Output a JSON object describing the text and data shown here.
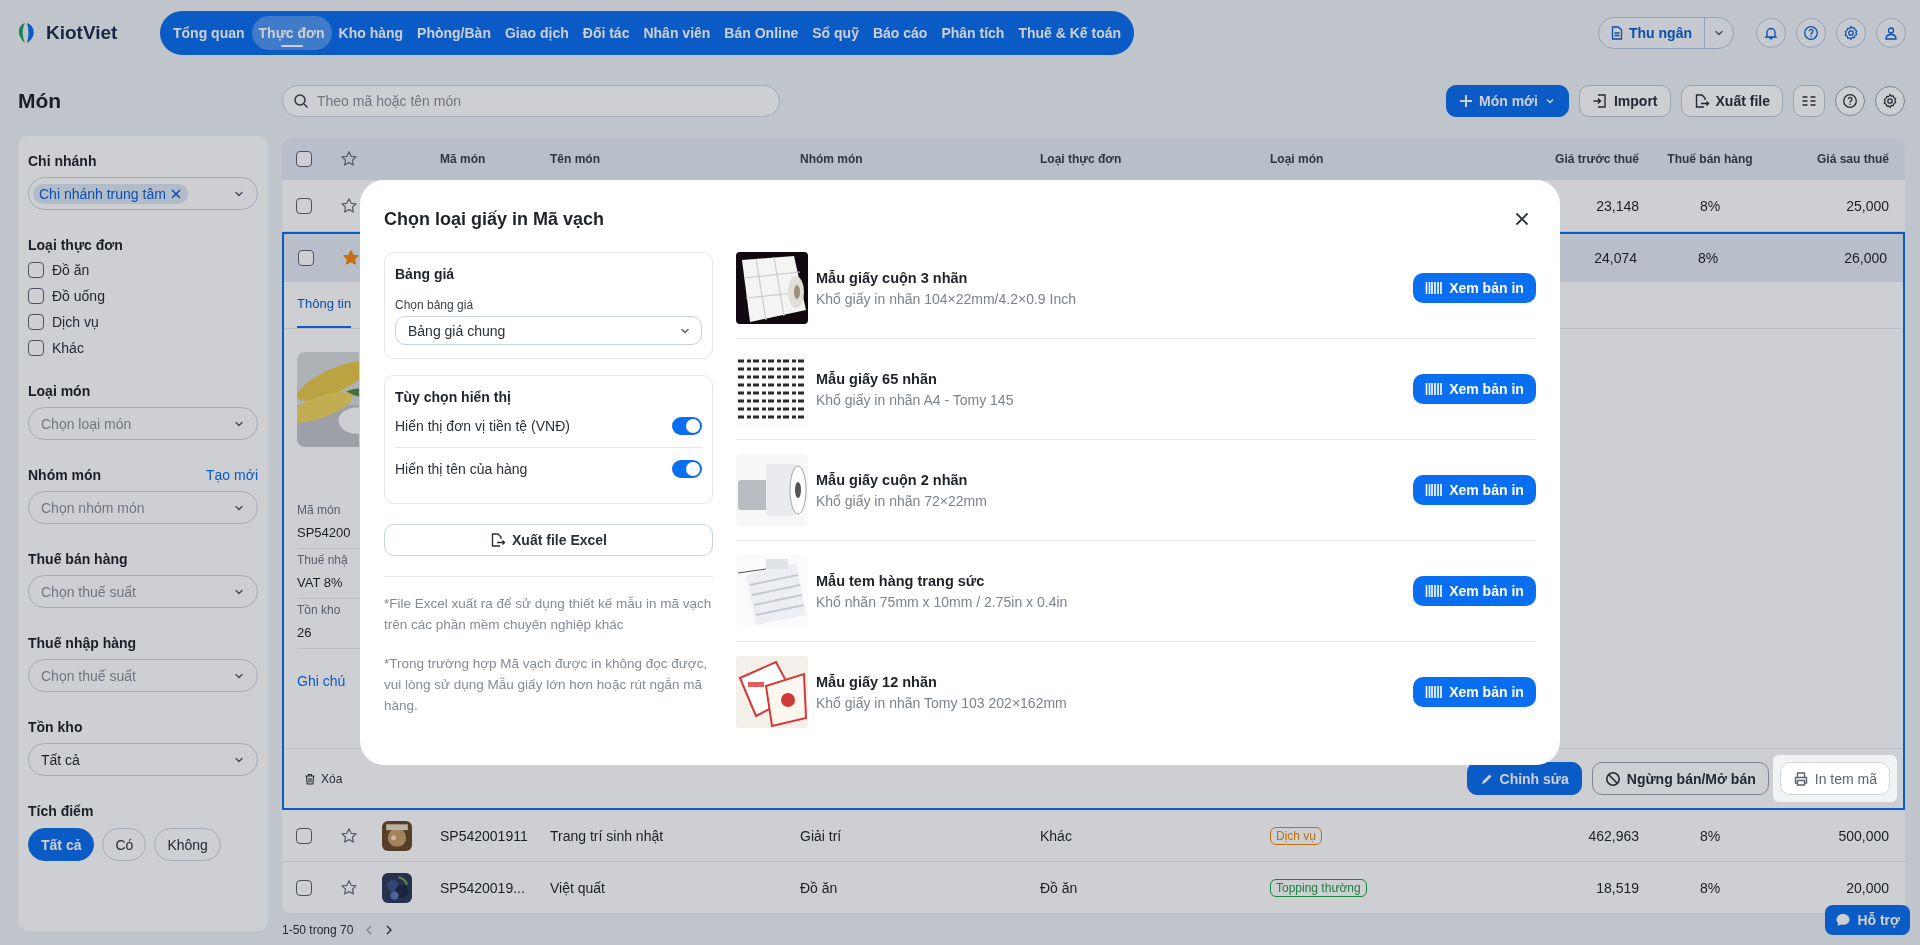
{
  "logo": {
    "text": "KiotViet"
  },
  "nav": [
    {
      "label": "Tổng quan",
      "selected": false
    },
    {
      "label": "Thực đơn",
      "selected": true
    },
    {
      "label": "Kho hàng",
      "selected": false
    },
    {
      "label": "Phòng/Bàn",
      "selected": false
    },
    {
      "label": "Giao dịch",
      "selected": false
    },
    {
      "label": "Đối tác",
      "selected": false
    },
    {
      "label": "Nhân viên",
      "selected": false
    },
    {
      "label": "Bán Online",
      "selected": false
    },
    {
      "label": "Sổ quỹ",
      "selected": false
    },
    {
      "label": "Báo cáo",
      "selected": false
    },
    {
      "label": "Phân tích",
      "selected": false
    },
    {
      "label": "Thuế & Kế toán",
      "selected": false
    }
  ],
  "cashier_button": "Thu ngân",
  "toolbar": {
    "title": "Món",
    "search_placeholder": "Theo mã hoặc tên món",
    "new_button": "Món mới",
    "import_button": "Import",
    "export_button": "Xuất file"
  },
  "filters": [
    {
      "kind": "tags",
      "label": "Chi nhánh",
      "tags": [
        "Chi nhánh trung tâm"
      ]
    },
    {
      "kind": "checks",
      "label": "Loại thực đơn",
      "options": [
        {
          "label": "Đồ ăn",
          "checked": false
        },
        {
          "label": "Đồ uống",
          "checked": false
        },
        {
          "label": "Dịch vụ",
          "checked": false
        },
        {
          "label": "Khác",
          "checked": false
        }
      ]
    },
    {
      "kind": "select",
      "label": "Loại món",
      "placeholder": "Chọn loại món"
    },
    {
      "kind": "select",
      "label": "Nhóm món",
      "link": "Tạo mới",
      "placeholder": "Chọn nhóm món"
    },
    {
      "kind": "select",
      "label": "Thuế bán hàng",
      "placeholder": "Chọn thuế suất"
    },
    {
      "kind": "select",
      "label": "Thuế nhập hàng",
      "placeholder": "Chọn thuế suất"
    },
    {
      "kind": "select",
      "label": "Tồn kho",
      "value": "Tất cả"
    },
    {
      "kind": "chips",
      "label": "Tích điểm",
      "options": [
        {
          "label": "Tất cả",
          "selected": true
        },
        {
          "label": "Có",
          "selected": false
        },
        {
          "label": "Không",
          "selected": false
        }
      ]
    }
  ],
  "table": {
    "header_checked": false,
    "columns": [
      "Mã món",
      "Tên món",
      "Nhóm món",
      "Loại thực đơn",
      "Loại món",
      "Giá trước thuế",
      "Thuế bán hàng",
      "Giá sau thuế"
    ],
    "rows": [
      {
        "checked": false,
        "starred": false,
        "expanded": false,
        "price_before": "23,148",
        "tax": "8%",
        "price_after": "25,000"
      },
      {
        "checked": false,
        "starred": true,
        "expanded": true,
        "price_before": "24,074",
        "tax": "8%",
        "price_after": "26,000",
        "detail": {
          "tabs": [
            {
              "label": "Thông tin",
              "selected": true
            }
          ],
          "fields": [
            {
              "label": "Mã món",
              "value": "SP54200"
            },
            {
              "label": "Thuế nhậ",
              "value": "VAT 8%"
            },
            {
              "label": "Tồn kho",
              "value": "26"
            }
          ],
          "note_link": "Ghi chú",
          "delete_button": "Xóa",
          "actions": [
            {
              "kind": "edit",
              "label": "Chỉnh sửa",
              "highlighted": false
            },
            {
              "kind": "stop",
              "label": "Ngừng bán/Mở bán",
              "highlighted": false
            },
            {
              "kind": "print",
              "label": "In tem mã",
              "highlighted": true
            }
          ]
        }
      },
      {
        "checked": false,
        "starred": false,
        "expanded": false,
        "code": "SP542001911",
        "name": "Trang trí sinh nhật",
        "group": "Giải trí",
        "menu_type": "Khác",
        "item_type": {
          "label": "Dịch vụ",
          "color": "#bc710f"
        },
        "price_before": "462,963",
        "tax": "8%",
        "price_after": "500,000"
      },
      {
        "checked": false,
        "starred": false,
        "expanded": false,
        "code": "SP5420019...",
        "name": "Việt quất",
        "group": "Đồ ăn",
        "menu_type": "Đồ ăn",
        "item_type": {
          "label": "Topping thường",
          "color": "#1b813e"
        },
        "price_before": "18,519",
        "tax": "8%",
        "price_after": "20,000"
      }
    ]
  },
  "pagination": "1-50 trong 70",
  "support_button": "Hỗ trợ",
  "dialog": {
    "title": "Chọn loại giấy in Mã vạch",
    "price_list": {
      "heading": "Bảng giá",
      "label": "Chọn bảng giá",
      "value": "Bảng giá chung"
    },
    "display_options": {
      "heading": "Tùy chọn hiển thị",
      "options": [
        {
          "label": "Hiển thị đơn vị tiền tệ (VNĐ)",
          "on": true
        },
        {
          "label": "Hiển thị tên của hàng",
          "on": true
        }
      ]
    },
    "export_button": "Xuất file Excel",
    "notes": [
      "*File Excel xuất ra để sử dụng thiết kế mẫu in mã vạch trên các phần mềm chuyên nghiệp khác",
      "*Trong trường hợp Mã vạch được in không đọc được, vui lòng sử dụng Mẫu giấy lớn hơn hoặc rút ngắn mã hàng."
    ],
    "templates": [
      {
        "name": "Mẫu giấy cuộn 3 nhãn",
        "size": "Khổ giấy in nhãn 104×22mm/4.2×0.9 Inch",
        "button": "Xem bản in"
      },
      {
        "name": "Mẫu giấy 65 nhãn",
        "size": "Khổ giấy in nhãn A4 - Tomy 145",
        "button": "Xem bản in"
      },
      {
        "name": "Mẫu giấy cuộn 2 nhãn",
        "size": "Khổ giấy in nhãn 72×22mm",
        "button": "Xem bản in"
      },
      {
        "name": "Mẫu tem hàng trang sức",
        "size": "Khổ nhãn 75mm x 10mm / 2.75in x 0.4in",
        "button": "Xem bản in"
      },
      {
        "name": "Mẫu giấy 12 nhãn",
        "size": "Khổ giấy in nhãn Tomy 103 202×162mm",
        "button": "Xem bản in"
      }
    ]
  }
}
